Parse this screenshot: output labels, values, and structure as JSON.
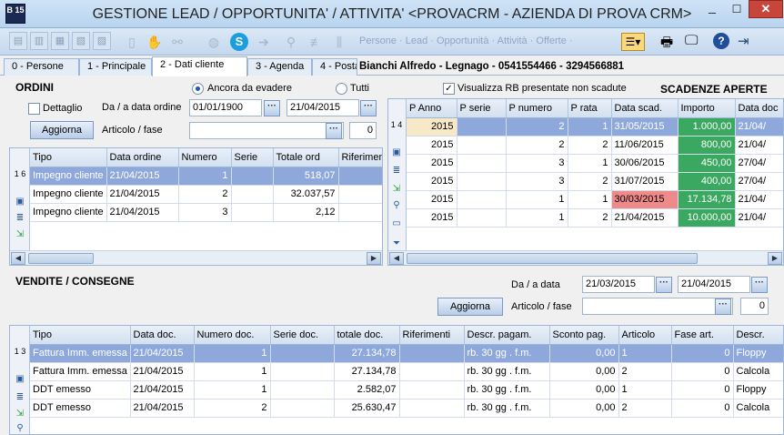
{
  "window": {
    "title": "GESTIONE LEAD / OPPORTUNITA' / ATTIVITA' <PROVACRM - AZIENDA DI PROVA CRM>",
    "app_icon_label": "B 15"
  },
  "toolbar": {
    "menu_text": "Persone · Lead · Opportunità · Attività · Offerte ·"
  },
  "tabs": [
    {
      "label": "0 - Persone"
    },
    {
      "label": "1 - Principale"
    },
    {
      "label": "2 - Dati cliente"
    },
    {
      "label": "3 - Agenda"
    },
    {
      "label": "4 - Posta"
    }
  ],
  "customer_info": "Bianchi Alfredo   - Legnago - 0541554466 - 3294566881",
  "ordini": {
    "title": "ORDINI",
    "dettaglio_label": "Dettaglio",
    "date_range_label": "Da / a data ordine",
    "date_from": "01/01/1900",
    "date_to": "21/04/2015",
    "radio_ancora": "Ancora da evadere",
    "radio_tutti": "Tutti",
    "aggiorna_label": "Aggiorna",
    "articolo_label": "Articolo / fase",
    "articolo_value": "",
    "fase_value": "0",
    "columns": [
      "Tipo",
      "Data ordine",
      "Numero",
      "Serie",
      "Totale ord",
      "Riferimenti"
    ],
    "rows": [
      {
        "tipo": "Impegno cliente",
        "data": "21/04/2015",
        "numero": "1",
        "serie": "",
        "totale": "518,07",
        "rif": ""
      },
      {
        "tipo": "Impegno cliente",
        "data": "21/04/2015",
        "numero": "2",
        "serie": "",
        "totale": "32.037,57",
        "rif": ""
      },
      {
        "tipo": "Impegno cliente",
        "data": "21/04/2015",
        "numero": "3",
        "serie": "",
        "totale": "2,12",
        "rif": ""
      }
    ],
    "row_counter": "1 6"
  },
  "scadenze": {
    "title": "SCADENZE APERTE",
    "checkbox_label": "Visualizza RB presentate non scadute",
    "columns": [
      "P Anno",
      "P serie",
      "P numero",
      "P rata",
      "Data scad.",
      "Importo",
      "Data doc"
    ],
    "rows": [
      {
        "anno": "2015",
        "serie": "",
        "numero": "2",
        "rata": "1",
        "data": "31/05/2015",
        "importo": "1.000,00",
        "datadoc": "21/04/"
      },
      {
        "anno": "2015",
        "serie": "",
        "numero": "2",
        "rata": "2",
        "data": "11/06/2015",
        "importo": "800,00",
        "datadoc": "21/04/"
      },
      {
        "anno": "2015",
        "serie": "",
        "numero": "3",
        "rata": "1",
        "data": "30/06/2015",
        "importo": "450,00",
        "datadoc": "27/04/"
      },
      {
        "anno": "2015",
        "serie": "",
        "numero": "3",
        "rata": "2",
        "data": "31/07/2015",
        "importo": "400,00",
        "datadoc": "27/04/"
      },
      {
        "anno": "2015",
        "serie": "",
        "numero": "1",
        "rata": "1",
        "data": "30/03/2015",
        "importo": "17.134,78",
        "datadoc": "21/04/"
      },
      {
        "anno": "2015",
        "serie": "",
        "numero": "1",
        "rata": "2",
        "data": "21/04/2015",
        "importo": "10.000,00",
        "datadoc": "21/04/"
      }
    ],
    "row_counter": "1 4"
  },
  "vendite": {
    "title": "VENDITE / CONSEGNE",
    "date_range_label": "Da / a data",
    "date_from": "21/03/2015",
    "date_to": "21/04/2015",
    "aggiorna_label": "Aggiorna",
    "articolo_label": "Articolo / fase",
    "articolo_value": "",
    "fase_value": "0",
    "columns": [
      "Tipo",
      "Data doc.",
      "Numero doc.",
      "Serie doc.",
      "totale doc.",
      "Riferimenti",
      "Descr. pagam.",
      "Sconto pag.",
      "Articolo",
      "Fase art.",
      "Descr."
    ],
    "rows": [
      {
        "tipo": "Fattura Imm. emessa",
        "data": "21/04/2015",
        "numero": "1",
        "serie": "",
        "totale": "27.134,78",
        "rif": "",
        "pagam": "rb. 30 gg . f.m.",
        "sconto": "0,00",
        "articolo": "1",
        "fase": "0",
        "descr": "Floppy"
      },
      {
        "tipo": "Fattura Imm. emessa",
        "data": "21/04/2015",
        "numero": "1",
        "serie": "",
        "totale": "27.134,78",
        "rif": "",
        "pagam": "rb. 30 gg . f.m.",
        "sconto": "0,00",
        "articolo": "2",
        "fase": "0",
        "descr": "Calcola"
      },
      {
        "tipo": "DDT emesso",
        "data": "21/04/2015",
        "numero": "1",
        "serie": "",
        "totale": "2.582,07",
        "rif": "",
        "pagam": "rb. 30 gg . f.m.",
        "sconto": "0,00",
        "articolo": "1",
        "fase": "0",
        "descr": "Floppy"
      },
      {
        "tipo": "DDT emesso",
        "data": "21/04/2015",
        "numero": "2",
        "serie": "",
        "totale": "25.630,47",
        "rif": "",
        "pagam": "rb. 30 gg . f.m.",
        "sconto": "0,00",
        "articolo": "2",
        "fase": "0",
        "descr": "Calcola"
      }
    ],
    "row_counter": "1 3"
  },
  "colors": {
    "selection": "#8ea8db",
    "overdue": "#ef8a8a",
    "amount_ok": "#3aa860"
  }
}
